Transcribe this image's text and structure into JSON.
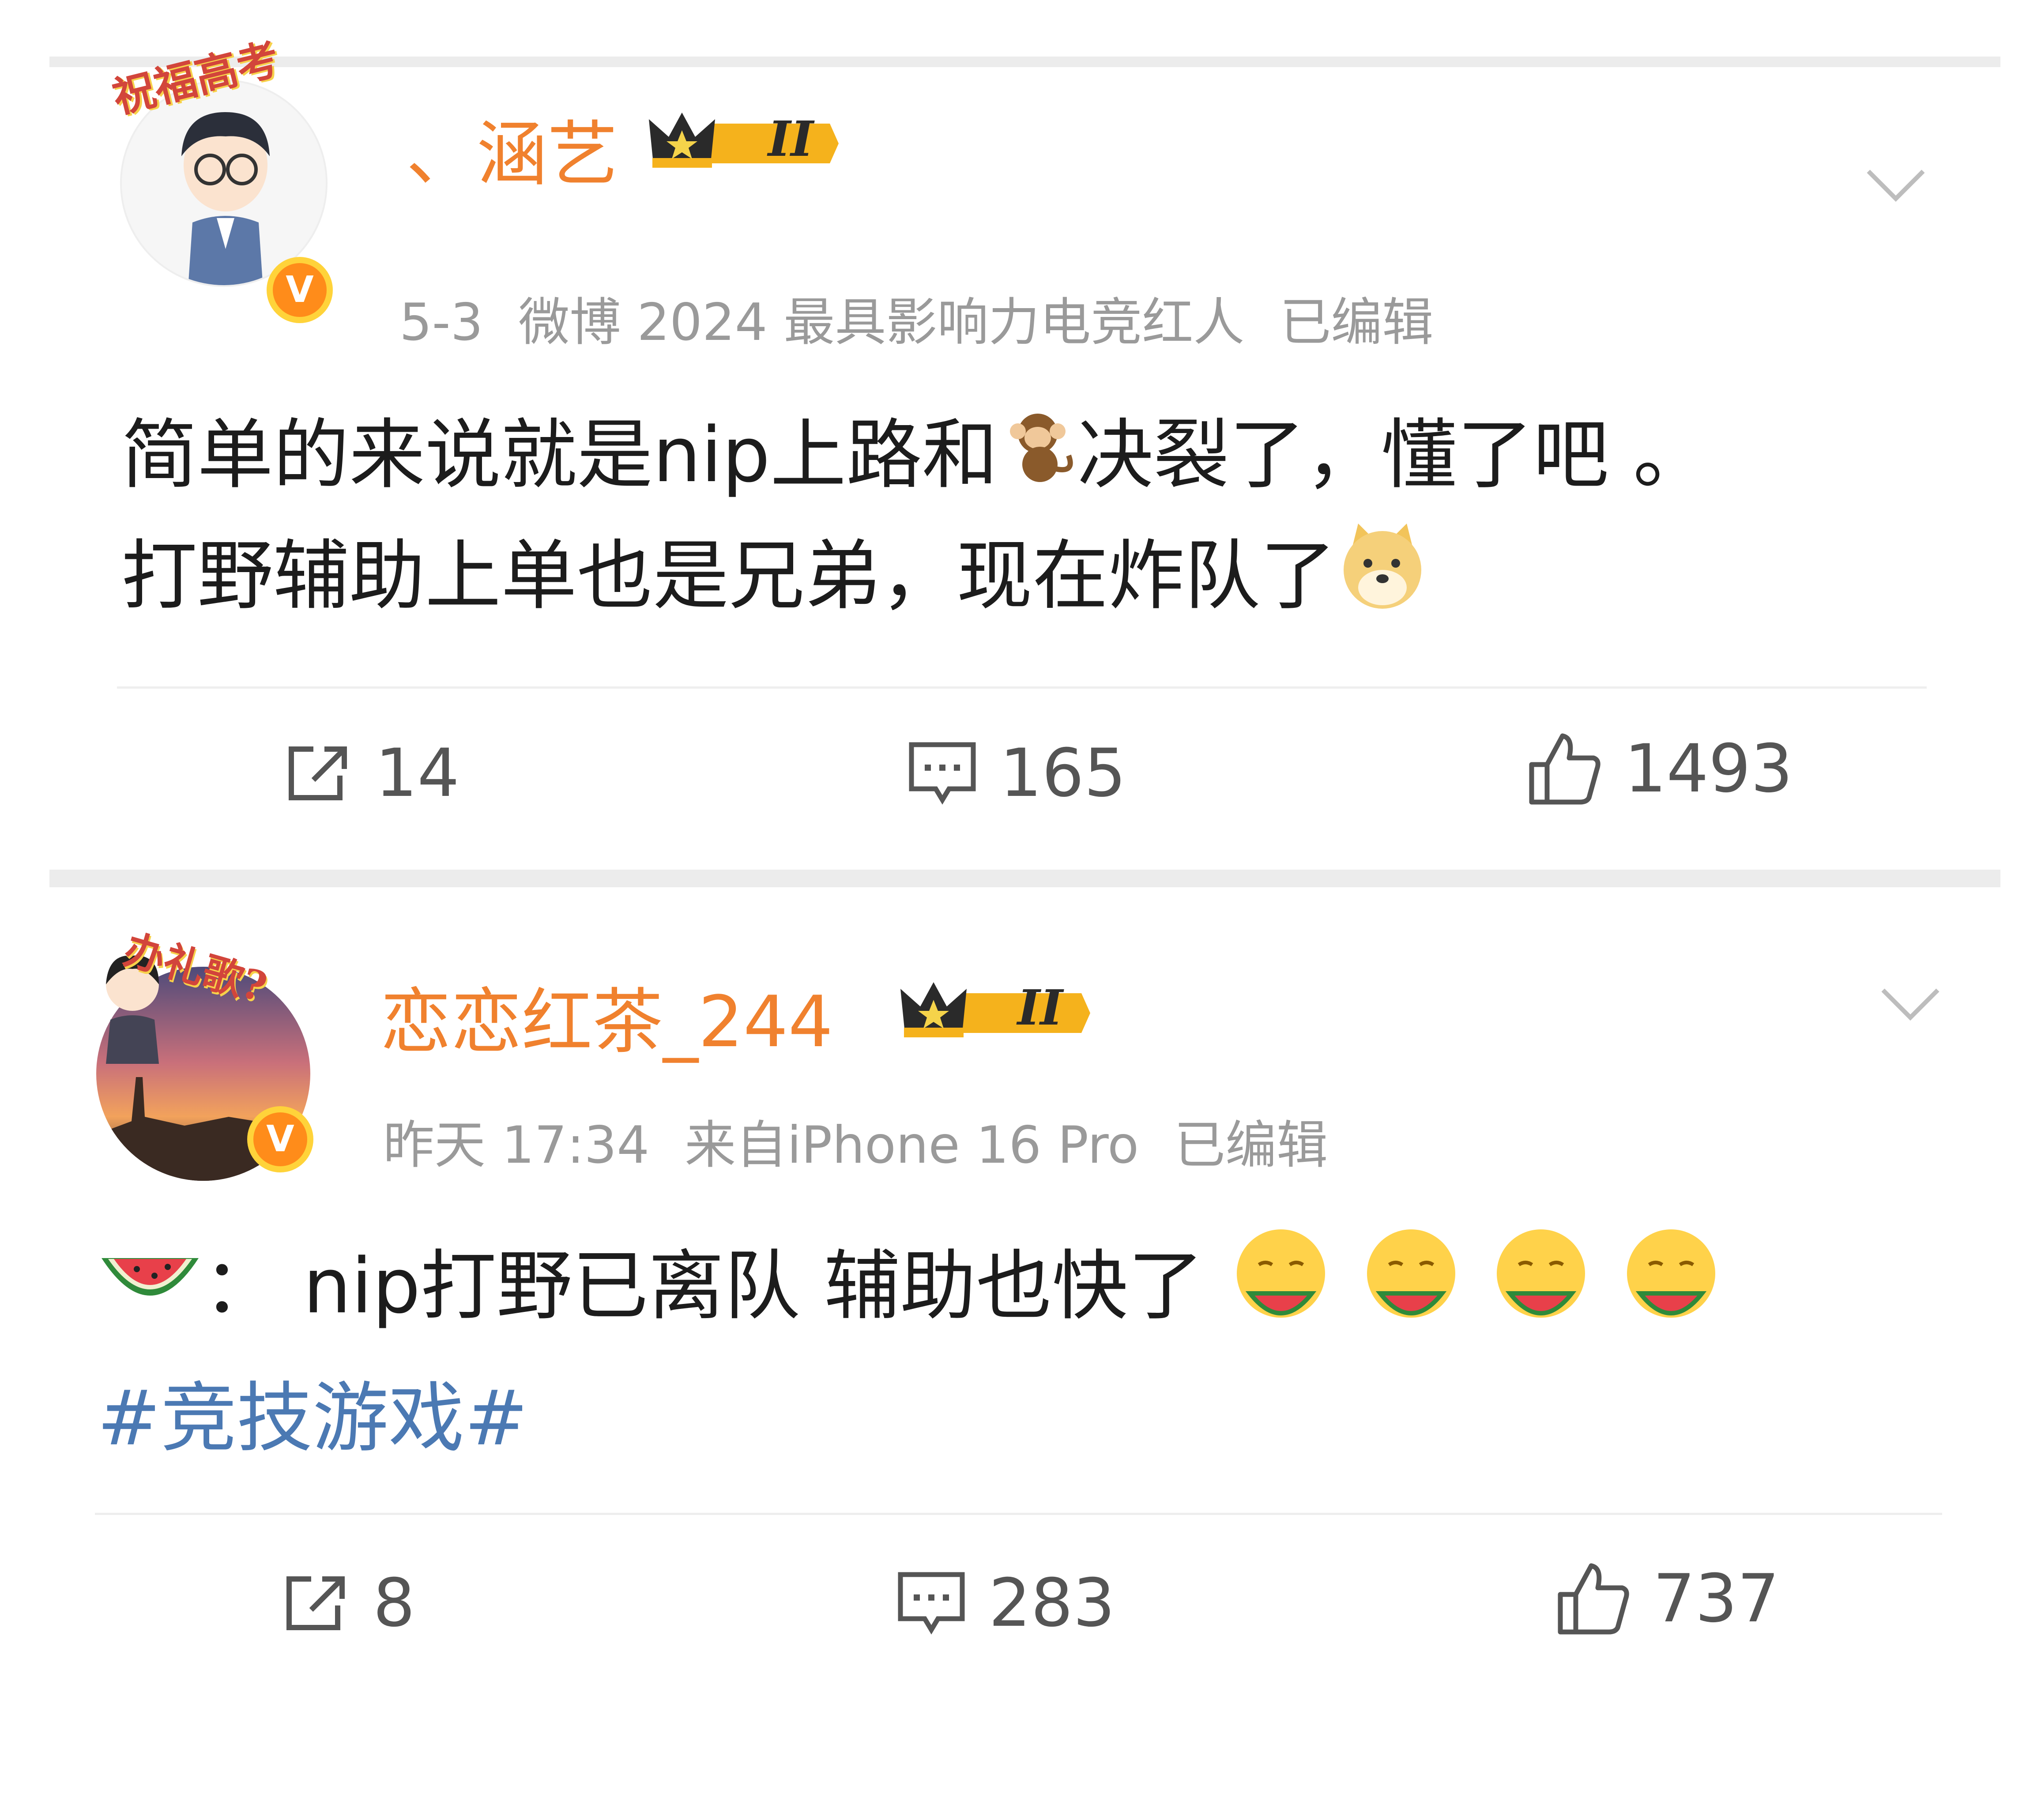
{
  "posts": [
    {
      "avatar_badge_text": "祝福高考",
      "username": "、涵艺",
      "level": "II",
      "meta": {
        "date": "5-3",
        "title": "微博 2024 最具影响力电竞红人",
        "edited": "已编辑"
      },
      "content": {
        "line1_a": "简单的来说就是nip上路和",
        "line1_b": "决裂了，懂了吧 。",
        "line2": "打野辅助上单也是兄弟，现在炸队了"
      },
      "actions": {
        "share": "14",
        "comment": "165",
        "like": "1493"
      }
    },
    {
      "avatar_badge_text": "办礼歌?",
      "username": "恋恋红茶_244",
      "level": "II",
      "meta": {
        "date": "昨天 17:34",
        "source": "来自iPhone 16 Pro",
        "edited": "已编辑"
      },
      "content": {
        "line1": "： nip打野已离队 辅助也快了",
        "hashtag": "#竞技游戏#"
      },
      "actions": {
        "share": "8",
        "comment": "283",
        "like": "737"
      }
    }
  ],
  "colors": {
    "username": "#f0812e",
    "hashtag": "#4b79b3",
    "meta": "#9a9a9a",
    "separator": "#ececec"
  }
}
